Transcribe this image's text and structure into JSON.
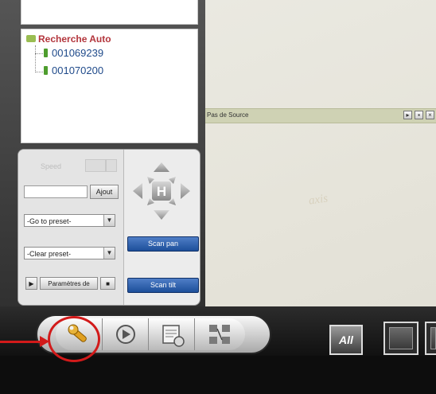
{
  "tree": {
    "root_label": "Recherche Auto",
    "items": [
      {
        "label": "001069239"
      },
      {
        "label": "001070200"
      }
    ]
  },
  "ptz": {
    "disabled_label": "Speed",
    "name_input_value": "",
    "add_button": "Ajout",
    "goto_preset": "-Go to preset-",
    "clear_preset": "-Clear preset-",
    "params_button": "Paramètres de",
    "center_label": "H",
    "scan_pan": "Scan pan",
    "scan_tilt": "Scan tilt"
  },
  "video": {
    "source_label": "Pas de Source",
    "watermark": "axis"
  },
  "toolbar": {
    "all_label": "All"
  },
  "icons": [
    "folder-icon",
    "camera-icon",
    "wrench-icon",
    "playback-icon",
    "calendar-icon",
    "network-icon",
    "play-icon",
    "stop-icon",
    "chevron-down-icon"
  ],
  "colors": {
    "accent_blue": "#1d4f9a",
    "tree_root": "#b3353c",
    "highlight": "#d21a1a"
  }
}
